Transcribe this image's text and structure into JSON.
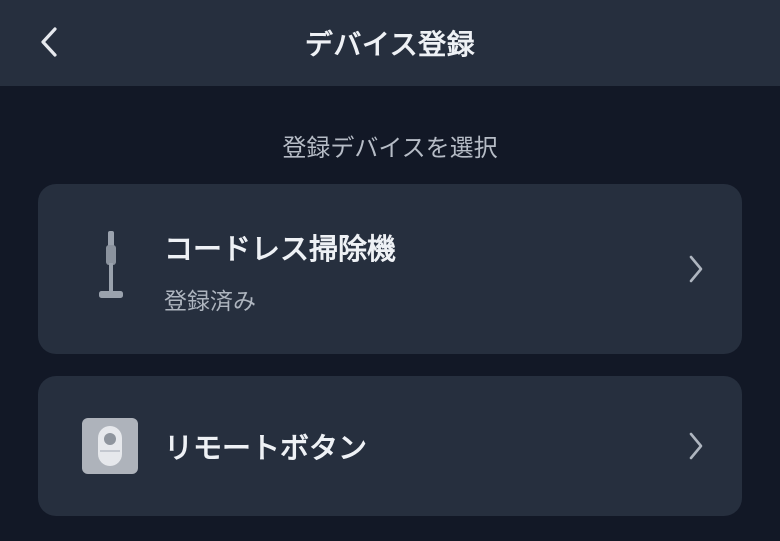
{
  "header": {
    "title": "デバイス登録",
    "back_icon": "chevron-left-icon"
  },
  "section": {
    "label": "登録デバイスを選択"
  },
  "devices": [
    {
      "name": "コードレス掃除機",
      "status": "登録済み",
      "icon": "stick-vacuum-icon"
    },
    {
      "name": "リモートボタン",
      "icon": "remote-button-icon"
    }
  ],
  "colors": {
    "background": "#121826",
    "surface": "#262f3e",
    "text_primary": "#eef1f5",
    "text_secondary": "#aeb5bf"
  }
}
